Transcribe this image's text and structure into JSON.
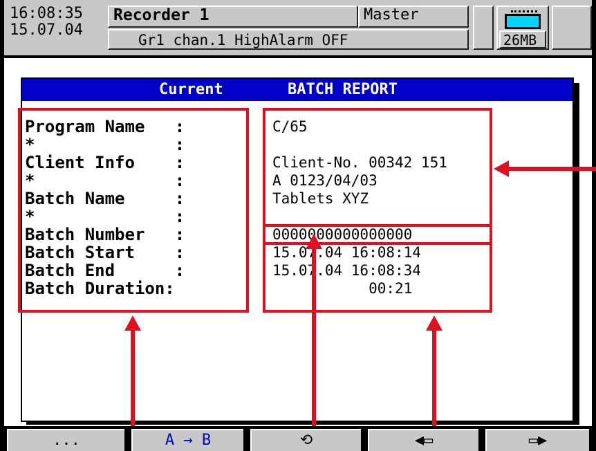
{
  "header": {
    "time": "16:08:35",
    "date": "15.07.04",
    "recorder_name": "Recorder 1",
    "role": "Master",
    "message": "Gr1 chan.1 HighAlarm OFF",
    "memory": "26MB"
  },
  "dialog": {
    "title_left": "Current",
    "title_right": "BATCH REPORT"
  },
  "fields": [
    {
      "label": "Program Name   :",
      "value": "C/65"
    },
    {
      "label": "*              :",
      "value": ""
    },
    {
      "label": "Client Info    :",
      "value": "Client-No. 00342 151"
    },
    {
      "label": "*              :",
      "value": "A 0123/04/03"
    },
    {
      "label": "Batch Name     :",
      "value": "Tablets XYZ"
    },
    {
      "label": "*              :",
      "value": ""
    },
    {
      "label": "Batch Number   :",
      "value": "0000000000000000"
    },
    {
      "label": "Batch Start    :",
      "value": "15.07.04 16:08:14"
    },
    {
      "label": "Batch End      :",
      "value": "15.07.04 16:08:34"
    },
    {
      "label": "Batch Duration:",
      "value": "           00:21"
    }
  ],
  "softkeys": [
    {
      "label": "...",
      "icon": "more-icon"
    },
    {
      "label": "A → B",
      "icon": "copy-a-to-b-icon"
    },
    {
      "label": "⟲",
      "icon": "rotate-icon"
    },
    {
      "label": "◀▭",
      "icon": "scroll-left-icon"
    },
    {
      "label": "▭▶",
      "icon": "scroll-right-icon"
    }
  ],
  "colors": {
    "title_bar": "#0000c8",
    "annotation": "#e01020",
    "battery": "#00d6ff"
  }
}
